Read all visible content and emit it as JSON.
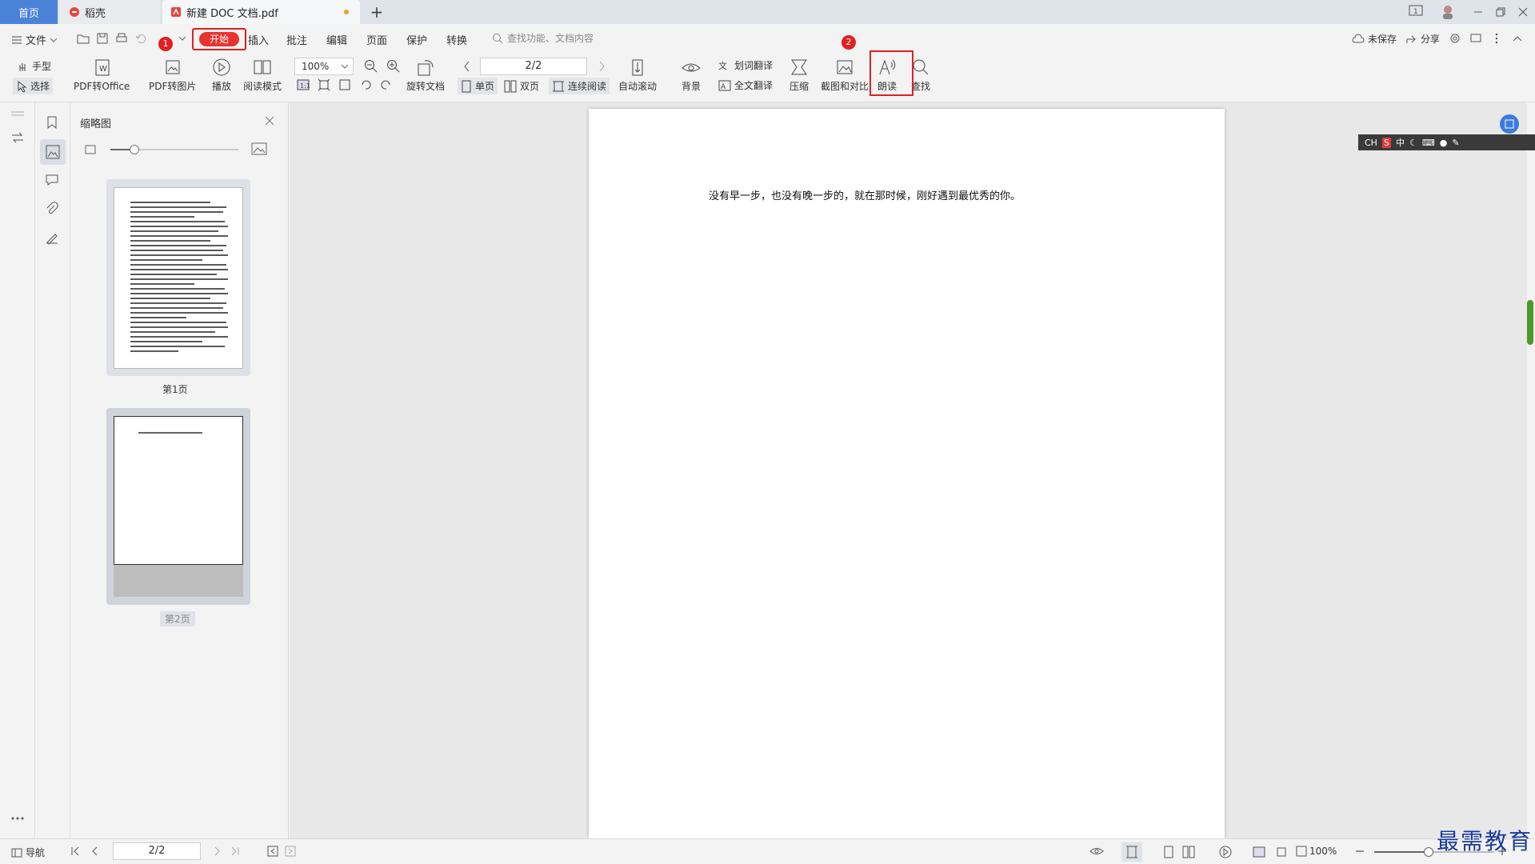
{
  "tabs": {
    "home": "首页",
    "daoke": "稻壳",
    "document": "新建 DOC 文档.pdf",
    "new_tab": "+"
  },
  "menu": {
    "file": "文件",
    "start": "开始",
    "insert": "插入",
    "annotate": "批注",
    "edit": "编辑",
    "page": "页面",
    "protect": "保护",
    "convert": "转换",
    "search_placeholder": "查找功能、文档内容",
    "unsaved": "未保存",
    "share": "分享",
    "badge1": "1",
    "badge2": "2"
  },
  "ribbon": {
    "hand": "手型",
    "select": "选择",
    "pdf_to_office": "PDF转Office",
    "pdf_to_image": "PDF转图片",
    "play": "播放",
    "reading_mode": "阅读模式",
    "zoom": "100%",
    "rotate_doc": "旋转文档",
    "page_value": "2/2",
    "single_page": "单页",
    "double_page": "双页",
    "continuous": "连续阅读",
    "auto_scroll": "自动滚动",
    "background": "背景",
    "word_translate": "划词翻译",
    "full_translate": "全文翻译",
    "compress": "压缩",
    "screenshot_compare": "截图和对比",
    "read_aloud": "朗读",
    "find": "查找"
  },
  "thumbnail_panel": {
    "title": "缩略图",
    "pages": [
      {
        "label": "第1页"
      },
      {
        "label": "第2页"
      }
    ]
  },
  "document": {
    "text": "没有早一步，也没有晚一步的，就在那时候，刚好遇到最优秀的你。"
  },
  "ime": {
    "ch": "CH",
    "zh": "中"
  },
  "status": {
    "nav": "导航",
    "page_value": "2/2",
    "zoom": "100%"
  },
  "watermark": "最需教育",
  "colors": {
    "accent": "#4a82d8",
    "highlight_red": "#e02020",
    "start_pill": "#e8332f"
  }
}
